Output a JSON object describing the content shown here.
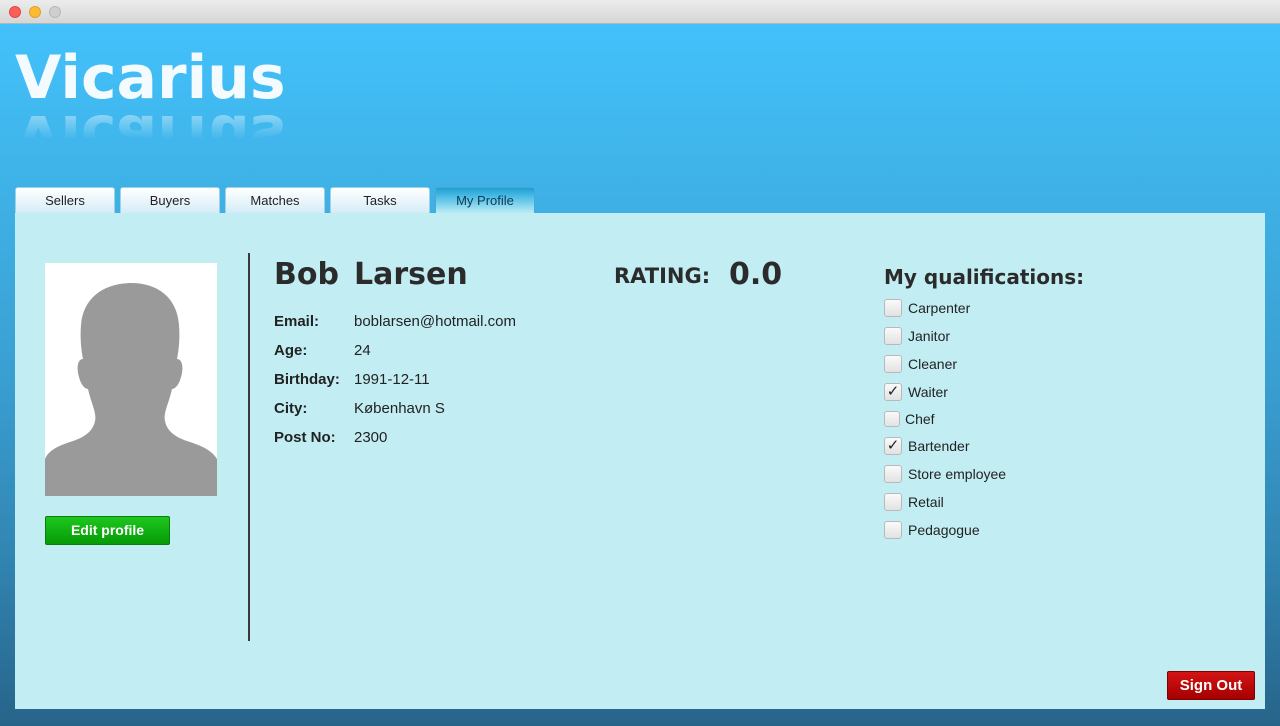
{
  "app": {
    "name": "Vicarius"
  },
  "tabs": [
    {
      "label": "Sellers",
      "active": false
    },
    {
      "label": "Buyers",
      "active": false
    },
    {
      "label": "Matches",
      "active": false
    },
    {
      "label": "Tasks",
      "active": false
    },
    {
      "label": "My Profile",
      "active": true
    }
  ],
  "profile": {
    "first_name": "Bob",
    "last_name": "Larsen",
    "edit_label": "Edit profile",
    "avatar_icon": "person-silhouette-icon",
    "fields": [
      {
        "label": "Email:",
        "value": "boblarsen@hotmail.com"
      },
      {
        "label": "Age:",
        "value": "24"
      },
      {
        "label": "Birthday:",
        "value": "1991-12-11"
      },
      {
        "label": "City:",
        "value": "København S"
      },
      {
        "label": "Post No:",
        "value": "2300"
      }
    ]
  },
  "rating": {
    "label": "RATING:",
    "value": "0.0"
  },
  "qualifications": {
    "title": "My qualifications:",
    "items": [
      {
        "label": "Carpenter",
        "checked": false
      },
      {
        "label": "Janitor",
        "checked": false
      },
      {
        "label": "Cleaner",
        "checked": false
      },
      {
        "label": "Waiter",
        "checked": true
      },
      {
        "label": "Chef",
        "checked": false
      },
      {
        "label": "Bartender",
        "checked": true
      },
      {
        "label": "Store employee",
        "checked": false
      },
      {
        "label": "Retail",
        "checked": false
      },
      {
        "label": "Pedagogue",
        "checked": false
      }
    ]
  },
  "sign_out_label": "Sign Out",
  "colors": {
    "header_top": "#43c1fb",
    "panel_bg": "#c2eef3",
    "edit_button": "#0aa80a",
    "sign_out_button": "#c00000"
  }
}
